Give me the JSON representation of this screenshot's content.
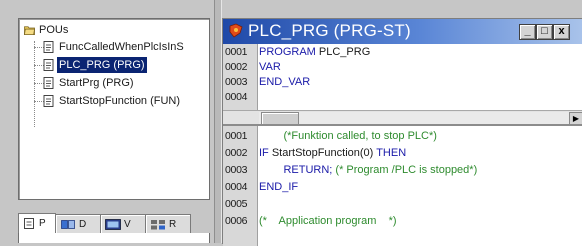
{
  "tree": {
    "root_label": "POUs",
    "items": [
      {
        "label": "FuncCalledWhenPlcIsInS",
        "selected": false
      },
      {
        "label": "PLC_PRG (PRG)",
        "selected": true
      },
      {
        "label": "StartPrg (PRG)",
        "selected": false
      },
      {
        "label": "StartStopFunction (FUN)",
        "selected": false
      }
    ]
  },
  "tabs": [
    {
      "label": "P",
      "icon": "pou-tab-icon",
      "active": true
    },
    {
      "label": "D",
      "icon": "datatypes-tab-icon",
      "active": false
    },
    {
      "label": "V",
      "icon": "visualization-tab-icon",
      "active": false
    },
    {
      "label": "R",
      "icon": "resources-tab-icon",
      "active": false
    }
  ],
  "editor": {
    "title": "PLC_PRG (PRG-ST)",
    "buttons": {
      "minimize": "_",
      "maximize": "□",
      "close": "x"
    },
    "declaration_lines": [
      {
        "num": "0001",
        "parts": [
          {
            "t": "PROGRAM ",
            "c": "kw"
          },
          {
            "t": "PLC_PRG",
            "c": "tx"
          }
        ]
      },
      {
        "num": "0002",
        "parts": [
          {
            "t": "VAR",
            "c": "kw"
          }
        ]
      },
      {
        "num": "0003",
        "parts": [
          {
            "t": "END_VAR",
            "c": "kw"
          }
        ]
      },
      {
        "num": "0004",
        "parts": []
      }
    ],
    "body_lines": [
      {
        "num": "0001",
        "parts": [
          {
            "t": "        (*Funktion called, to stop PLC*)",
            "c": "cm"
          }
        ]
      },
      {
        "num": "0002",
        "parts": [
          {
            "t": "IF ",
            "c": "kw"
          },
          {
            "t": "StartStopFunction(0) ",
            "c": "tx"
          },
          {
            "t": "THEN",
            "c": "kw"
          }
        ]
      },
      {
        "num": "0003",
        "parts": [
          {
            "t": "        RETURN; ",
            "c": "kw"
          },
          {
            "t": "(* Program /PLC is stopped*)",
            "c": "cm"
          }
        ]
      },
      {
        "num": "0004",
        "parts": [
          {
            "t": "END_IF",
            "c": "kw"
          }
        ]
      },
      {
        "num": "0005",
        "parts": []
      },
      {
        "num": "0006",
        "parts": [
          {
            "t": "(*    Application program    *)",
            "c": "cm"
          }
        ]
      }
    ]
  },
  "colors": {
    "selection": "#0a2472",
    "keyword": "#1a1aa8",
    "comment": "#2e8b2e",
    "title_bar_start": "#1f49a8"
  }
}
